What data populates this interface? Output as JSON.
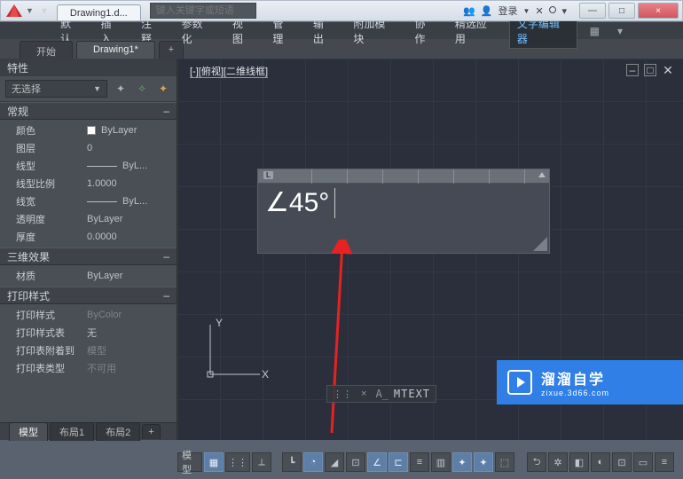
{
  "title": {
    "doc": "Drawing1.d..."
  },
  "search_placeholder": "键入关键字或短语",
  "user": {
    "label": "登录"
  },
  "window": {
    "min": "—",
    "max": "□",
    "close": "×"
  },
  "menu": {
    "items": [
      "默认",
      "插入",
      "注释",
      "参数化",
      "视图",
      "管理",
      "输出",
      "附加模块",
      "协作",
      "精选应用",
      "文字编辑器"
    ]
  },
  "doctabs": {
    "start": "开始",
    "current": "Drawing1*",
    "plus": "+"
  },
  "properties": {
    "title": "特性",
    "selector": "无选择",
    "groups": [
      {
        "name": "常规",
        "rows": [
          {
            "label": "颜色",
            "value": "ByLayer",
            "swatch": true
          },
          {
            "label": "图层",
            "value": "0"
          },
          {
            "label": "线型",
            "value": "ByL...",
            "line": true
          },
          {
            "label": "线型比例",
            "value": "1.0000"
          },
          {
            "label": "线宽",
            "value": "ByL...",
            "line": true
          },
          {
            "label": "透明度",
            "value": "ByLayer"
          },
          {
            "label": "厚度",
            "value": "0.0000"
          }
        ]
      },
      {
        "name": "三维效果",
        "rows": [
          {
            "label": "材质",
            "value": "ByLayer"
          }
        ]
      },
      {
        "name": "打印样式",
        "rows": [
          {
            "label": "打印样式",
            "value": "ByColor",
            "dim": true
          },
          {
            "label": "打印样式表",
            "value": "无"
          },
          {
            "label": "打印表附着到",
            "value": "模型",
            "dim": true
          },
          {
            "label": "打印表类型",
            "value": "不可用",
            "dim": true
          }
        ]
      }
    ]
  },
  "layout_tabs": [
    "模型",
    "布局1",
    "布局2"
  ],
  "viewport": {
    "label_a": "[-]",
    "label_b": "[俯视]",
    "label_c": "[二维线框]"
  },
  "text_editor": {
    "content": "∠45°",
    "ruler_L": "L"
  },
  "ucs": {
    "x": "X",
    "y": "Y"
  },
  "command": {
    "prompt": "A_",
    "text": "MTEXT",
    "grip": "⋮⋮",
    "close": "×"
  },
  "brand": {
    "name": "溜溜自学",
    "url": "zixue.3d66.com"
  },
  "status": {
    "model": "模型"
  }
}
